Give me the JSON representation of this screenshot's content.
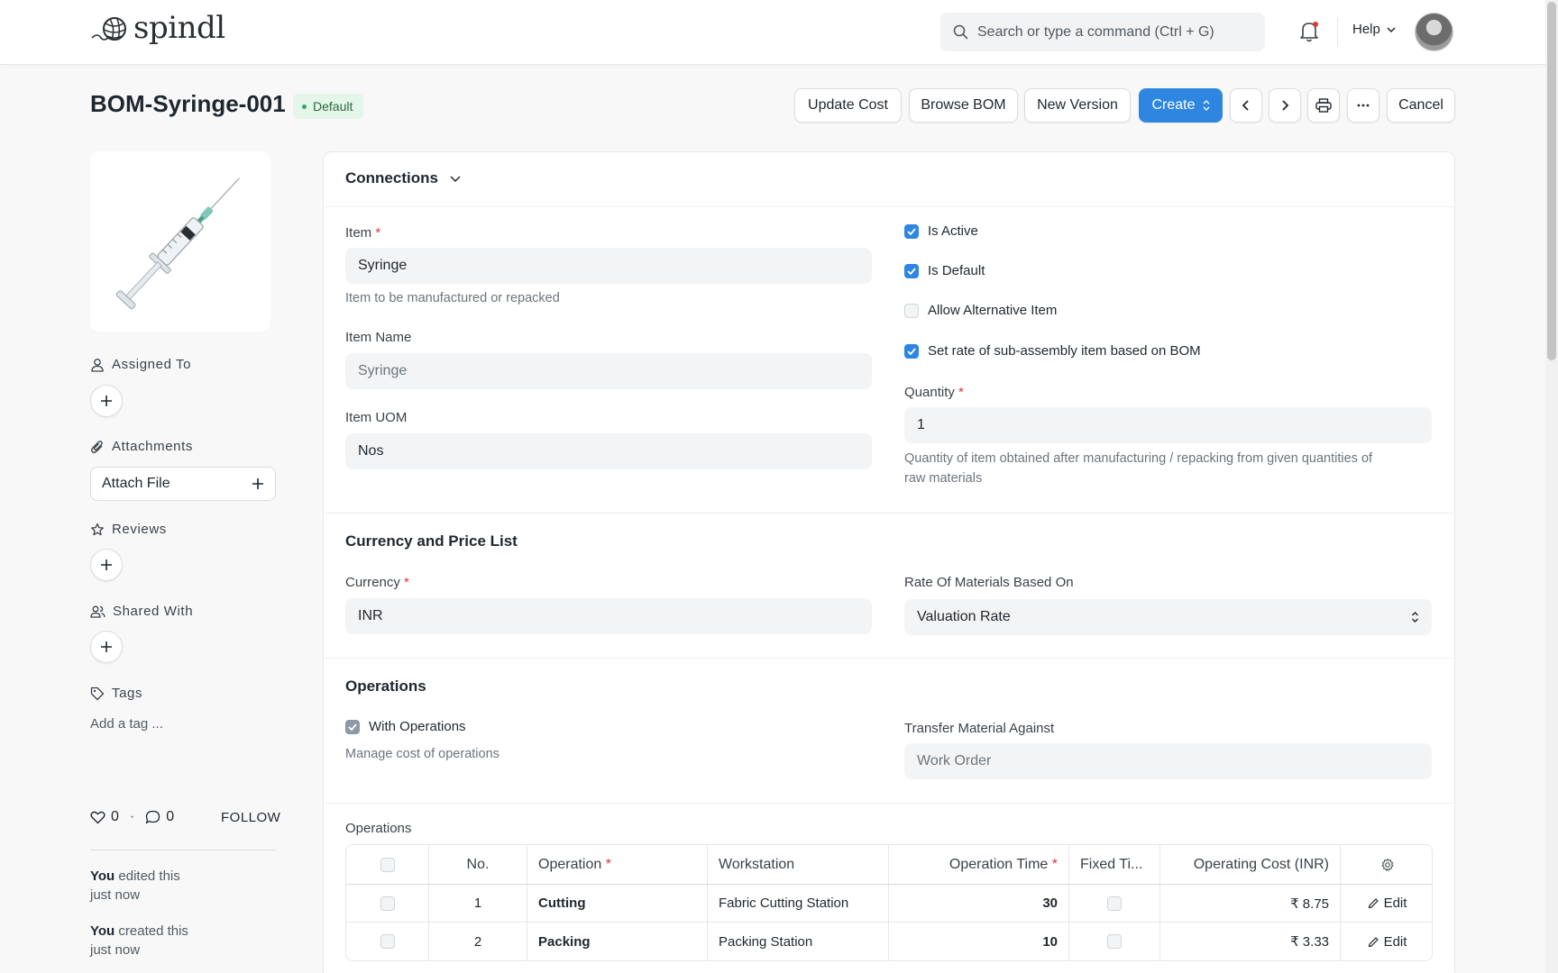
{
  "app": {
    "name": "spindl"
  },
  "navbar": {
    "search_placeholder": "Search or type a command (Ctrl + G)",
    "help_label": "Help"
  },
  "header": {
    "title": "BOM-Syringe-001",
    "status": "Default",
    "buttons": {
      "update_cost": "Update Cost",
      "browse_bom": "Browse BOM",
      "new_version": "New Version",
      "create": "Create",
      "cancel": "Cancel"
    }
  },
  "sidebar": {
    "assigned_to": "Assigned To",
    "attachments": "Attachments",
    "attach_file": "Attach File",
    "reviews": "Reviews",
    "shared_with": "Shared With",
    "tags": "Tags",
    "add_tag": "Add a tag ...",
    "likes": "0",
    "comments": "0",
    "follow": "FOLLOW",
    "activity": [
      {
        "who": "You",
        "what": " edited this",
        "when": "just now"
      },
      {
        "who": "You",
        "what": " created this",
        "when": "just now"
      }
    ]
  },
  "form": {
    "connections": "Connections",
    "item": {
      "label": "Item",
      "value": "Syringe",
      "help": "Item to be manufactured or repacked"
    },
    "item_name": {
      "label": "Item Name",
      "value": "Syringe"
    },
    "item_uom": {
      "label": "Item UOM",
      "value": "Nos"
    },
    "checks": {
      "is_active": "Is Active",
      "is_default": "Is Default",
      "allow_alternative": "Allow Alternative Item",
      "set_rate": "Set rate of sub-assembly item based on BOM"
    },
    "quantity": {
      "label": "Quantity",
      "value": "1",
      "help_line1": "Quantity of item obtained after manufacturing / repacking from given quantities of",
      "help_line2": "raw materials"
    },
    "currency_section": "Currency and Price List",
    "currency": {
      "label": "Currency",
      "value": "INR"
    },
    "rate_based_on": {
      "label": "Rate Of Materials Based On",
      "value": "Valuation Rate"
    },
    "operations_section": "Operations",
    "with_operations": {
      "label": "With Operations",
      "help": "Manage cost of operations"
    },
    "transfer_against": {
      "label": "Transfer Material Against",
      "value": "Work Order"
    },
    "operations_table": {
      "label": "Operations",
      "headers": {
        "no": "No.",
        "operation": "Operation",
        "workstation": "Workstation",
        "time": "Operation Time",
        "fixed": "Fixed Ti...",
        "cost": "Operating Cost (INR)"
      },
      "rows": [
        {
          "no": "1",
          "operation": "Cutting",
          "workstation": "Fabric Cutting Station",
          "time": "30",
          "cost": "₹ 8.75",
          "edit": "Edit"
        },
        {
          "no": "2",
          "operation": "Packing",
          "workstation": "Packing Station",
          "time": "10",
          "cost": "₹ 3.33",
          "edit": "Edit"
        }
      ]
    }
  }
}
